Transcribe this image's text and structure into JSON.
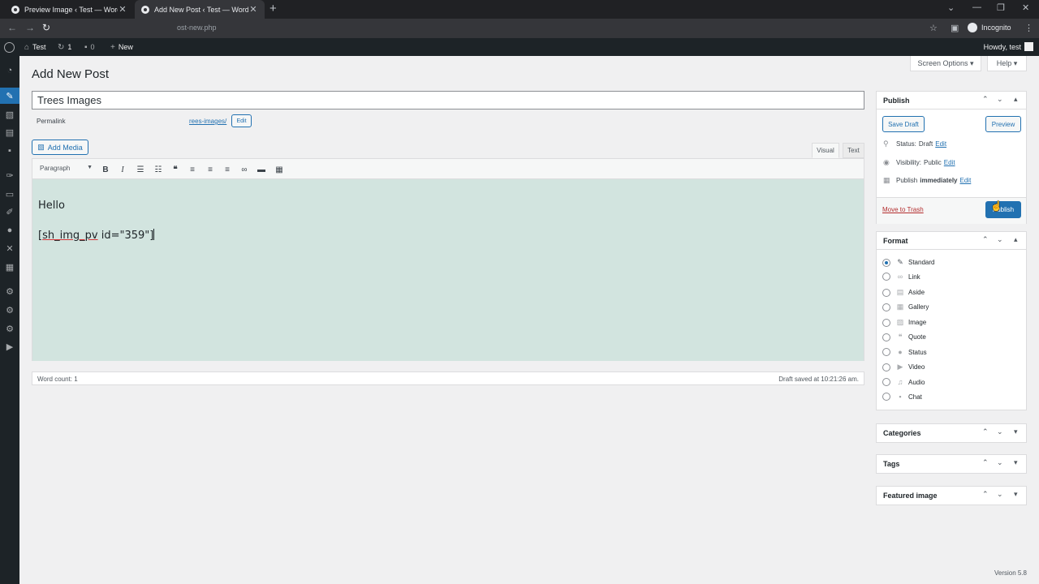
{
  "browser": {
    "tabs": [
      {
        "title": "Preview Image ‹ Test — WordPre",
        "active": false
      },
      {
        "title": "Add New Post ‹ Test — WordPre",
        "active": true
      }
    ],
    "new_tab": "+",
    "url": "ost-new.php",
    "incognito_label": "Incognito"
  },
  "adminbar": {
    "site_name": "Test",
    "updates_count": "1",
    "comments_count": "0",
    "new_label": "New",
    "howdy": "Howdy, test"
  },
  "header": {
    "screen_options": "Screen Options ▾",
    "help": "Help ▾",
    "page_title": "Add New Post"
  },
  "post": {
    "title": "Trees Images",
    "permalink_label": "Permalink",
    "permalink_url": "rees-images/",
    "permalink_edit": "Edit",
    "add_media": "Add Media",
    "tab_visual": "Visual",
    "tab_text": "Text",
    "format_select": "Paragraph",
    "content_line1": "Hello",
    "content_line2_a": "[",
    "content_line2_u": "sh_img_pv",
    "content_line2_b": " id=\"359\"]",
    "word_count": "Word count: 1",
    "draft_saved": "Draft saved at 10:21:26 am."
  },
  "publish": {
    "title": "Publish",
    "save_draft": "Save Draft",
    "preview": "Preview",
    "status_label": "Status:",
    "status_value": "Draft",
    "visibility_label": "Visibility:",
    "visibility_value": "Public",
    "publish_label": "Publish",
    "publish_value": "immediately",
    "edit": "Edit",
    "move_to_trash": "Move to Trash",
    "publish_button": "Publish"
  },
  "format": {
    "title": "Format",
    "options": [
      {
        "label": "Standard",
        "icon": "pin-icon",
        "checked": true
      },
      {
        "label": "Link",
        "icon": "link-icon",
        "checked": false
      },
      {
        "label": "Aside",
        "icon": "aside-icon",
        "checked": false
      },
      {
        "label": "Gallery",
        "icon": "gallery-icon",
        "checked": false
      },
      {
        "label": "Image",
        "icon": "image-icon",
        "checked": false
      },
      {
        "label": "Quote",
        "icon": "quote-icon",
        "checked": false
      },
      {
        "label": "Status",
        "icon": "status-icon",
        "checked": false
      },
      {
        "label": "Video",
        "icon": "video-icon",
        "checked": false
      },
      {
        "label": "Audio",
        "icon": "audio-icon",
        "checked": false
      },
      {
        "label": "Chat",
        "icon": "chat-icon",
        "checked": false
      }
    ]
  },
  "boxes": {
    "categories": "Categories",
    "tags": "Tags",
    "featured_image": "Featured image"
  },
  "footer": {
    "version": "Version 5.8"
  },
  "colors": {
    "accent": "#2271b1",
    "editor_bg": "#d2e4df",
    "admin_dark": "#1d2327"
  }
}
